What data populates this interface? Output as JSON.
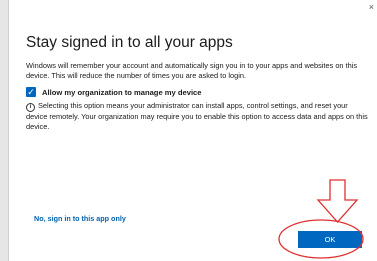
{
  "dialog": {
    "close_glyph": "×",
    "title": "Stay signed in to all your apps",
    "description": "Windows will remember your account and automatically sign you in to your apps and websites on this device. This will reduce the number of times you are asked to login.",
    "allow_checkbox": {
      "checked": true,
      "label": "Allow my organization to manage my device"
    },
    "info_text": "Selecting this option means your administrator can install apps, control settings, and reset your device remotely. Your organization may require you to enable this option to access data and apps on this device.",
    "no_link": "No, sign in to this app only",
    "ok_label": "OK"
  },
  "annotations": {
    "arrow_color": "#e03030",
    "circle_color": "#e03030",
    "target": "ok-button"
  },
  "colors": {
    "accent": "#0067c0",
    "link": "#0063b1",
    "background": "#ffffff"
  }
}
